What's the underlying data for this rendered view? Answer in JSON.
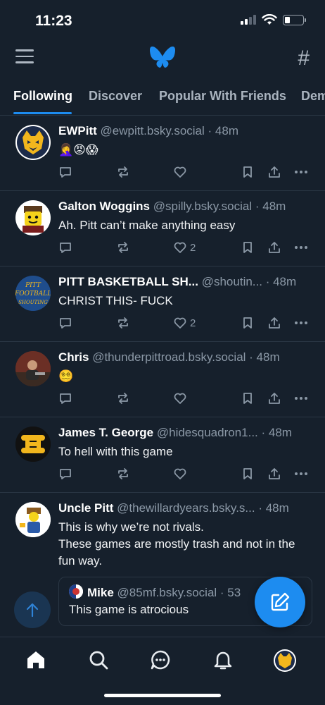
{
  "status_bar": {
    "time": "11:23"
  },
  "header": {
    "menu_icon": "menu-icon",
    "logo_icon": "butterfly-icon",
    "feeds_icon": "hash-icon",
    "hash_glyph": "#"
  },
  "tabs": [
    {
      "label": "Following",
      "active": true
    },
    {
      "label": "Discover",
      "active": false
    },
    {
      "label": "Popular With Friends",
      "active": false
    },
    {
      "label": "Dem",
      "active": false
    }
  ],
  "posts": [
    {
      "author": "EWPitt",
      "handle": "@ewpitt.bsky.social",
      "time": "· 48m",
      "text": "🤦‍♀️😡😱",
      "likes": ""
    },
    {
      "author": "Galton Woggins",
      "handle": "@spilly.bsky.social",
      "time": "· 48m",
      "text": "Ah. Pitt can’t make anything easy",
      "likes": "2"
    },
    {
      "author": "PITT BASKETBALL SH...",
      "handle": "@shoutin...",
      "time": "· 48m",
      "text": "CHRIST THIS- FUCK",
      "likes": "2"
    },
    {
      "author": "Chris",
      "handle": "@thunderpittroad.bsky.social",
      "time": "· 48m",
      "text": "😵‍💫",
      "likes": ""
    },
    {
      "author": "James T. George",
      "handle": "@hidesquadron1...",
      "time": "· 48m",
      "text": "To hell with this game",
      "likes": ""
    },
    {
      "author": "Uncle Pitt",
      "handle": "@thewillardyears.bsky.s...",
      "time": "· 48m",
      "text_lines": [
        "This is why we’re not rivals.",
        "These games are mostly trash and not in the fun way."
      ]
    }
  ],
  "quote": {
    "author": "Mike",
    "handle": "@85mf.bsky.social",
    "time": "· 53",
    "text": "This game is atrocious"
  },
  "colors": {
    "accent": "#1d8cf0",
    "background": "#16202c",
    "muted": "#8b98a6",
    "divider": "#2a3644"
  },
  "bottom_nav": [
    "home-icon",
    "search-icon",
    "chat-icon",
    "bell-icon",
    "profile-avatar"
  ]
}
